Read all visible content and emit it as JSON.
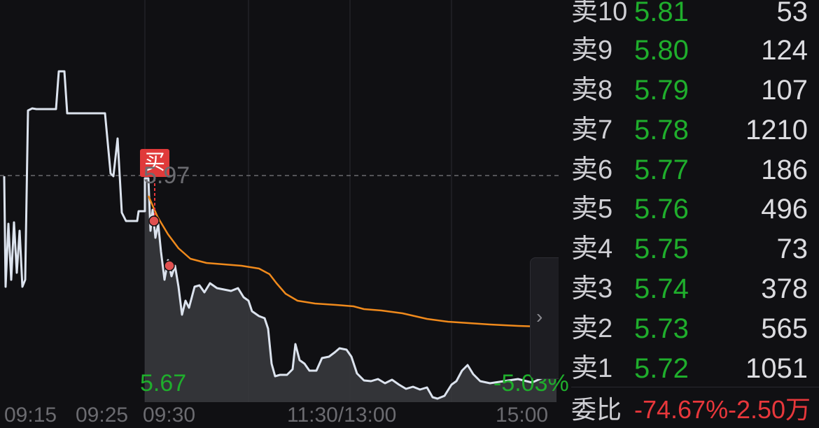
{
  "order_book": {
    "asks": [
      {
        "label": "卖10",
        "price": "5.81",
        "volume": "53"
      },
      {
        "label": "卖9",
        "price": "5.80",
        "volume": "124"
      },
      {
        "label": "卖8",
        "price": "5.79",
        "volume": "107"
      },
      {
        "label": "卖7",
        "price": "5.78",
        "volume": "1210"
      },
      {
        "label": "卖6",
        "price": "5.77",
        "volume": "186"
      },
      {
        "label": "卖5",
        "price": "5.76",
        "volume": "496"
      },
      {
        "label": "卖4",
        "price": "5.75",
        "volume": "73"
      },
      {
        "label": "卖3",
        "price": "5.74",
        "volume": "378"
      },
      {
        "label": "卖2",
        "price": "5.73",
        "volume": "565"
      },
      {
        "label": "卖1",
        "price": "5.72",
        "volume": "1051"
      }
    ],
    "ratio_label": "委比",
    "ratio_value": "-74.67%",
    "ratio_amount": "-2.50万"
  },
  "chart": {
    "buy_marker": "买",
    "ref_price": "5.97",
    "low_price": "5.67",
    "low_pct": "-5.03%",
    "time_labels": [
      "09:15",
      "09:25",
      "09:30",
      "11:30/13:00",
      "15:00"
    ],
    "expand_icon": "chevron-right-icon"
  },
  "colors": {
    "background": "#101013",
    "price_line": "#dce3ee",
    "avg_line": "#f08a1c",
    "down_green": "#1fae2c",
    "up_red": "#e8373b"
  }
}
